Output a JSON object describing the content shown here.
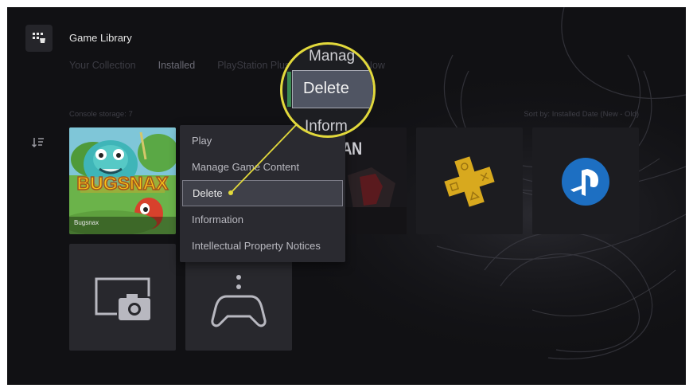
{
  "header": {
    "title": "Game Library",
    "tabs": [
      {
        "label": "Your Collection",
        "active": false
      },
      {
        "label": "Installed",
        "active": true
      },
      {
        "label": "PlayStation Plus",
        "active": false
      },
      {
        "label": "PlayStation Now",
        "active": false
      }
    ]
  },
  "storage_label": "Console storage: 7",
  "sort_label": "Sort by: Installed Date (New - Old)",
  "tiles": {
    "bugsnax": {
      "label": "Bugsnax",
      "logo_text": "BUGSNAX"
    },
    "spiderman": {
      "title": "ER-MAN"
    },
    "ps_plus": {
      "name": "PlayStation Plus"
    },
    "ps_now": {
      "name": "PlayStation Now"
    },
    "media_gallery": {
      "name": "Media Gallery"
    },
    "remote_play": {
      "name": "PS Remote Play"
    }
  },
  "context_menu": {
    "items": [
      "Play",
      "Manage Game Content",
      "Delete",
      "Information",
      "Intellectual Property Notices"
    ],
    "selected_index": 2
  },
  "zoom": {
    "top_text": "Manag",
    "selected_text": "Delete",
    "bottom_text": "Inform"
  },
  "colors": {
    "highlight_ring": "#e2d93c",
    "ps_plus_gold": "#d8a91e",
    "ps_now_blue": "#1d6fc2",
    "screen_bg": "#111114"
  },
  "icons": [
    "game-library-icon",
    "sort-icon",
    "ps-plus-icon",
    "ps-now-icon",
    "media-gallery-icon",
    "controller-icon"
  ]
}
